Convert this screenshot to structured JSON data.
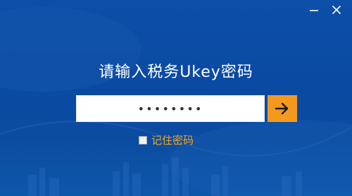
{
  "window": {
    "minimize_icon": "minimize-icon",
    "close_icon": "close-icon"
  },
  "login": {
    "title": "请输入税务Ukey密码",
    "password_value": "••••••••",
    "submit_icon": "arrow-right-icon",
    "remember_label": "记住密码",
    "remember_checked": false
  },
  "colors": {
    "background": "#0b4ca3",
    "submit_button": "#f39a1e",
    "remember_label": "#f0a528",
    "title_text": "#ffffff"
  }
}
